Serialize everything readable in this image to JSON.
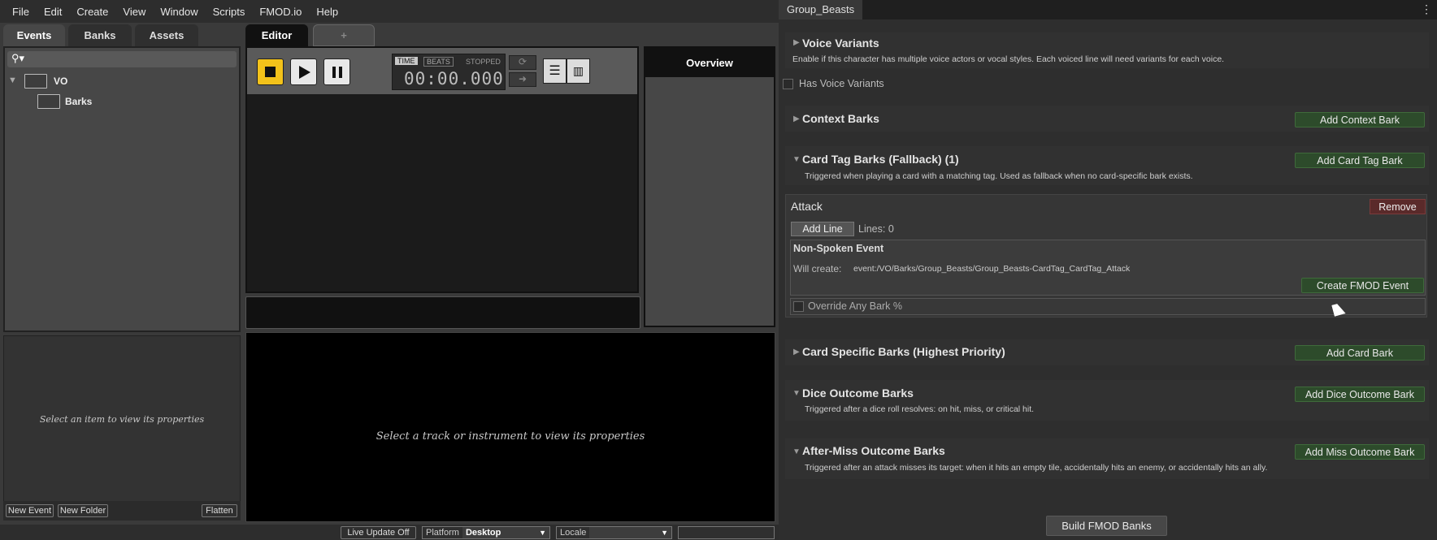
{
  "menu": [
    "File",
    "Edit",
    "Create",
    "View",
    "Window",
    "Scripts",
    "FMOD.io",
    "Help"
  ],
  "browser_tabs": {
    "events": "Events",
    "banks": "Banks",
    "assets": "Assets"
  },
  "tree": {
    "root": "VO",
    "child": "Barks"
  },
  "props_placeholder": "Select an item to view its properties",
  "bottom_buttons": {
    "new_event": "New Event",
    "new_folder": "New Folder",
    "flatten": "Flatten"
  },
  "editor_tabs": {
    "editor": "Editor",
    "add": "+"
  },
  "transport": {
    "time": "TIME",
    "beats": "BEATS",
    "state": "STOPPED",
    "timecode": "00:00.000"
  },
  "overview": "Overview",
  "track_placeholder": "Select a track or instrument to view its properties",
  "status": {
    "live_update": "Live Update Off",
    "platform_label": "Platform",
    "platform_value": "Desktop",
    "locale_label": "Locale"
  },
  "right": {
    "title": "Group_Beasts",
    "voice_variants": {
      "title": "Voice Variants",
      "desc": "Enable if this character has multiple voice actors or vocal styles. Each voiced line will need variants for each voice.",
      "checkbox": "Has Voice Variants"
    },
    "context": {
      "title": "Context Barks",
      "button": "Add Context Bark"
    },
    "cardtag": {
      "title": "Card Tag Barks (Fallback) (1)",
      "button": "Add Card Tag Bark",
      "desc": "Triggered when playing a card with a matching tag. Used as fallback when no card-specific bark exists.",
      "entry": {
        "name": "Attack",
        "remove": "Remove",
        "add_line": "Add Line",
        "lines": "Lines: 0",
        "nonspoken": "Non-Spoken Event",
        "will_create": "Will create:",
        "path": "event:/VO/Barks/Group_Beasts/Group_Beasts-CardTag_CardTag_Attack",
        "create": "Create FMOD Event",
        "override": "Override Any Bark %"
      }
    },
    "cardspecific": {
      "title": "Card Specific Barks (Highest Priority)",
      "button": "Add Card Bark"
    },
    "dice": {
      "title": "Dice Outcome Barks",
      "button": "Add Dice Outcome Bark",
      "desc": "Triggered after a dice roll resolves: on hit, miss, or critical hit."
    },
    "aftermiss": {
      "title": "After-Miss Outcome Barks",
      "button": "Add Miss Outcome Bark",
      "desc": "Triggered after an attack misses its target: when it hits an empty tile, accidentally hits an enemy, or accidentally hits an ally."
    },
    "build": "Build FMOD Banks"
  }
}
